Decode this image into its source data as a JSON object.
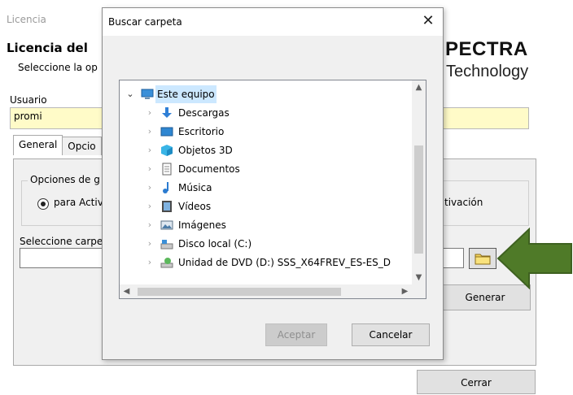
{
  "background": {
    "window_title": "Licencia",
    "heading": "Licencia del",
    "subtitle": "Seleccione la op",
    "logo_line1": "PECTRA",
    "logo_line2": "Technology",
    "user_label": "Usuario",
    "user_value": "promi",
    "tabs": [
      {
        "label": "General"
      },
      {
        "label": "Opcio"
      }
    ],
    "group_title": "Opciones de g",
    "radio_label": "para Activ",
    "activation_label": "tivación",
    "folder_label": "Seleccione carpe",
    "folder_value": "",
    "generate_button": "Generar",
    "close_button": "Cerrar"
  },
  "dialog": {
    "title": "Buscar carpeta",
    "close_glyph": "✕",
    "tree": [
      {
        "label": "Este equipo",
        "icon": "computer-icon",
        "expanded": true,
        "selected": true
      },
      {
        "label": "Descargas",
        "icon": "download-icon"
      },
      {
        "label": "Escritorio",
        "icon": "desktop-icon"
      },
      {
        "label": "Objetos 3D",
        "icon": "cube-icon"
      },
      {
        "label": "Documentos",
        "icon": "document-icon"
      },
      {
        "label": "Música",
        "icon": "music-icon"
      },
      {
        "label": "Vídeos",
        "icon": "video-icon"
      },
      {
        "label": "Imágenes",
        "icon": "image-icon"
      },
      {
        "label": "Disco local (C:)",
        "icon": "drive-icon"
      },
      {
        "label": "Unidad de DVD (D:) SSS_X64FREV_ES-ES_D",
        "icon": "dvd-icon"
      }
    ],
    "accept_button": "Aceptar",
    "cancel_button": "Cancelar"
  },
  "colors": {
    "highlight": "#cce8ff",
    "user_field_bg": "#fffbc8",
    "arrow": "#4f7a28"
  }
}
